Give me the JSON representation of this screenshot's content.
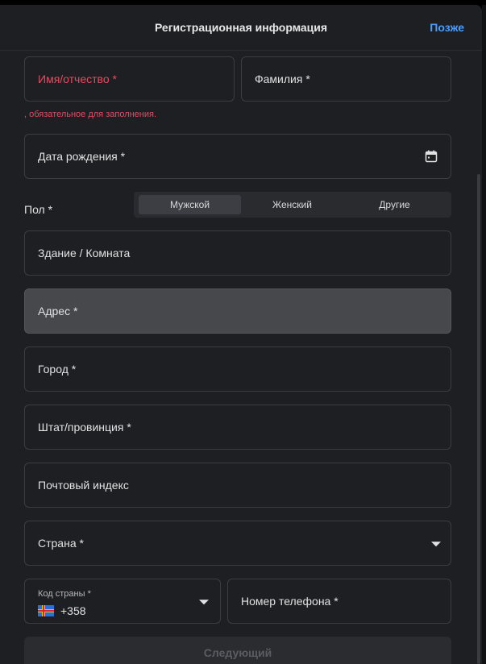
{
  "header": {
    "title": "Регистрационная информация",
    "later_label": "Позже"
  },
  "form": {
    "first_name_label": "Имя/отчество *",
    "last_name_label": "Фамилия *",
    "error_message": ", обязательное для заполнения.",
    "birth_date_label": "Дата рождения *",
    "gender_label": "Пол *",
    "gender_options": [
      "Мужской",
      "Женский",
      "Другие"
    ],
    "gender_selected": "Мужской",
    "building_label": "Здание / Комната",
    "address_label": "Адрес *",
    "city_label": "Город *",
    "state_label": "Штат/провинция *",
    "postal_label": "Почтовый индекс",
    "country_label": "Страна *",
    "country_code_label": "Код страны *",
    "country_code_value": "+358",
    "phone_label": "Номер телефона *",
    "next_label": "Следующий"
  },
  "colors": {
    "accent": "#4a9eff",
    "error": "#e84a5f",
    "background": "#1e1f22"
  }
}
